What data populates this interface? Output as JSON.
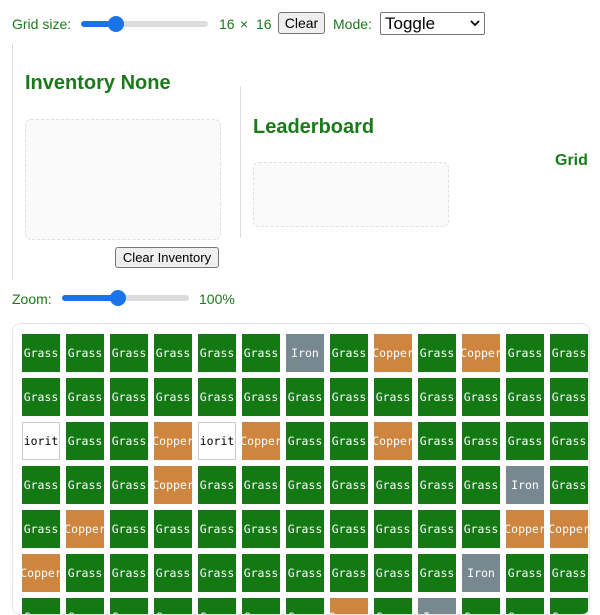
{
  "controls": {
    "grid_size_label": "Grid size:",
    "grid_size": {
      "value_x": "16",
      "times": "×",
      "value_y": "16",
      "slider_fraction": 0.25
    },
    "clear_label": "Clear",
    "mode_label": "Mode:",
    "mode_value": "Toggle",
    "zoom_label": "Zoom:",
    "zoom_value": "100%",
    "zoom_fraction": 0.45
  },
  "inventory": {
    "title": "Inventory None",
    "clear_button": "Clear Inventory"
  },
  "leaderboard": {
    "title": "Leaderboard"
  },
  "grid_title": "Grid",
  "colors": {
    "grass": "#137a13",
    "copper": "#cd853f",
    "iron": "#778891",
    "diorite": "#ffffff",
    "accent": "#1a73e8",
    "text_green": "#1a7a1a"
  },
  "grid": {
    "rows": [
      [
        "Grass",
        "Grass",
        "Grass",
        "Grass",
        "Grass",
        "Grass",
        "Iron",
        "Grass",
        "Copper",
        "Grass",
        "Copper",
        "Grass",
        "Grass"
      ],
      [
        "Grass",
        "Grass",
        "Grass",
        "Grass",
        "Grass",
        "Grass",
        "Grass",
        "Grass",
        "Grass",
        "Grass",
        "Grass",
        "Grass",
        "Grass"
      ],
      [
        "Diorite",
        "Grass",
        "Grass",
        "Copper",
        "Diorite",
        "Copper",
        "Grass",
        "Grass",
        "Copper",
        "Grass",
        "Grass",
        "Grass",
        "Grass"
      ],
      [
        "Grass",
        "Grass",
        "Grass",
        "Copper",
        "Grass",
        "Grass",
        "Grass",
        "Grass",
        "Grass",
        "Grass",
        "Grass",
        "Iron",
        "Grass"
      ],
      [
        "Grass",
        "Copper",
        "Grass",
        "Grass",
        "Grass",
        "Grass",
        "Grass",
        "Grass",
        "Grass",
        "Grass",
        "Grass",
        "Copper",
        "Copper"
      ],
      [
        "Copper",
        "Grass",
        "Grass",
        "Grass",
        "Grass",
        "Grass",
        "Grass",
        "Grass",
        "Grass",
        "Grass",
        "Iron",
        "Grass",
        "Grass"
      ],
      [
        "Grass",
        "Grass",
        "Grass",
        "Grass",
        "Grass",
        "Grass",
        "Grass",
        "Copper",
        "Grass",
        "Iron",
        "Grass",
        "Grass",
        "Grass"
      ]
    ]
  }
}
